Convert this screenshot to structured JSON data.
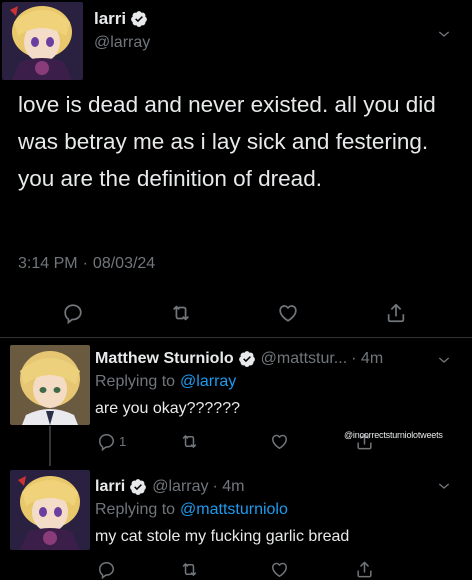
{
  "main_tweet": {
    "display_name": "larri",
    "handle": "@larray",
    "text": "love is dead and never existed. all you did was betray me as i lay sick and festering. you are the definition of dread.",
    "time": "3:14 PM",
    "separator": "·",
    "date": "08/03/24"
  },
  "reply_1": {
    "display_name": "Matthew Sturniolo",
    "handle": "@mattstur...",
    "time": "· 4m",
    "replying_prefix": "Replying to",
    "replying_to": "@larray",
    "text": "are you okay??????",
    "reply_count": "1"
  },
  "reply_2": {
    "display_name": "larri",
    "handle": "@larray",
    "time": "· 4m",
    "replying_prefix": "Replying to",
    "replying_to": "@mattsturniolo",
    "text": "my cat stole my fucking garlic bread"
  },
  "watermark": "@incorrectsturniolotweets",
  "colors": {
    "background": "#000000",
    "text": "#e7e9ea",
    "muted": "#71767b",
    "link": "#1d9bf0",
    "divider": "#2f3336"
  },
  "icons": [
    "verified-badge-icon",
    "chevron-down-icon",
    "reply-icon",
    "retweet-icon",
    "like-icon",
    "share-icon"
  ]
}
